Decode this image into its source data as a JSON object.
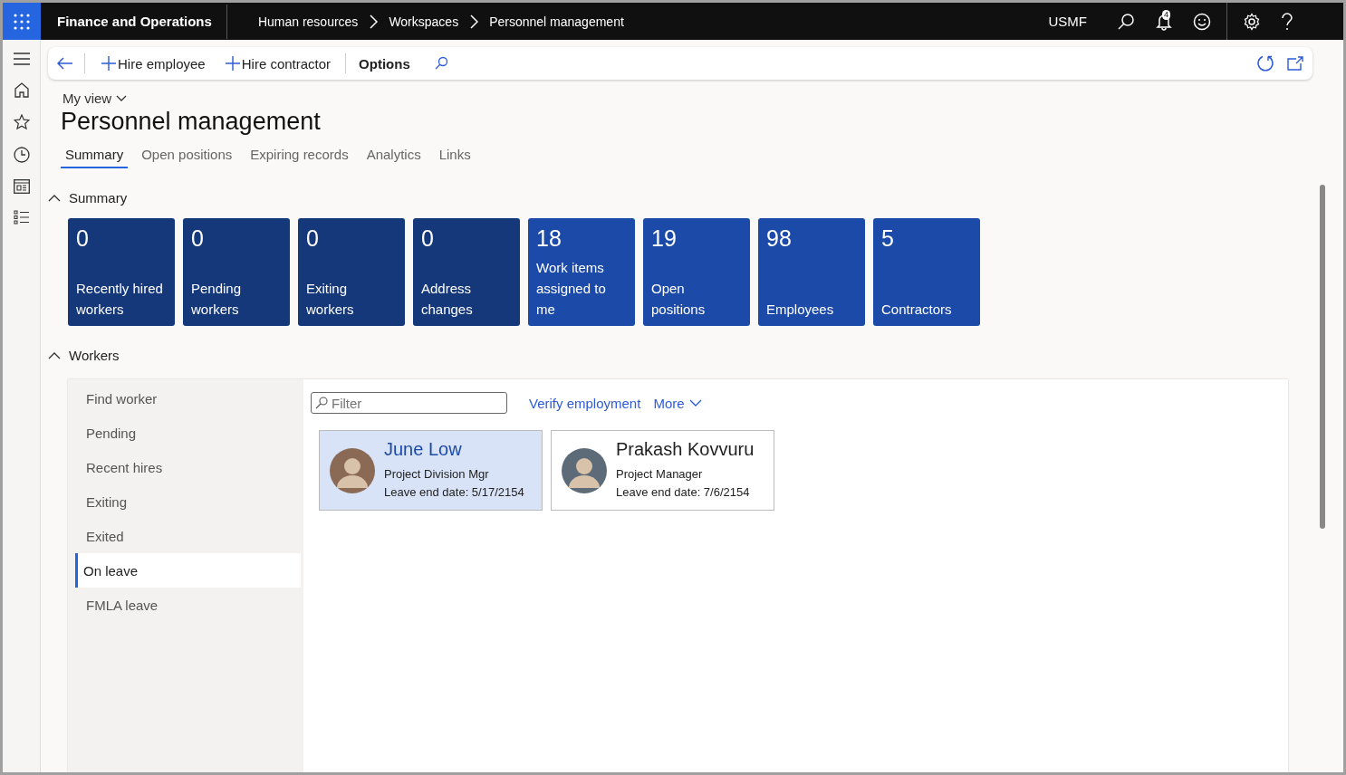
{
  "app": {
    "name": "Finance and Operations"
  },
  "breadcrumb": [
    "Human resources",
    "Workspaces",
    "Personnel management"
  ],
  "company": "USMF",
  "notifications": {
    "count": "4"
  },
  "action_pane": {
    "buttons": [
      {
        "label": "Hire employee",
        "kind": "add"
      },
      {
        "label": "Hire contractor",
        "kind": "add"
      },
      {
        "label": "Options",
        "kind": "plain"
      }
    ]
  },
  "view": {
    "label": "My view"
  },
  "page_title": "Personnel management",
  "tabs": [
    {
      "label": "Summary",
      "selected": true
    },
    {
      "label": "Open positions",
      "selected": false
    },
    {
      "label": "Expiring records",
      "selected": false
    },
    {
      "label": "Analytics",
      "selected": false
    },
    {
      "label": "Links",
      "selected": false
    }
  ],
  "summary": {
    "title": "Summary",
    "expanded": true,
    "tiles": [
      {
        "count": "0",
        "label": "Recently hired workers",
        "color": "#14387a"
      },
      {
        "count": "0",
        "label": "Pending workers",
        "color": "#14387a"
      },
      {
        "count": "0",
        "label": "Exiting workers",
        "color": "#14387a"
      },
      {
        "count": "0",
        "label": "Address changes",
        "color": "#14387a"
      },
      {
        "count": "18",
        "label": "Work items assigned to me",
        "color": "#1c4aa8"
      },
      {
        "count": "19",
        "label": "Open positions",
        "color": "#1c4aa8"
      },
      {
        "count": "98",
        "label": "Employees",
        "color": "#1c4aa8"
      },
      {
        "count": "5",
        "label": "Contractors",
        "color": "#1c4aa8"
      }
    ]
  },
  "workers": {
    "title": "Workers",
    "expanded": true,
    "filters": [
      {
        "label": "Find worker",
        "selected": false
      },
      {
        "label": "Pending",
        "selected": false
      },
      {
        "label": "Recent hires",
        "selected": false
      },
      {
        "label": "Exiting",
        "selected": false
      },
      {
        "label": "Exited",
        "selected": false
      },
      {
        "label": "On leave",
        "selected": true
      },
      {
        "label": "FMLA leave",
        "selected": false
      }
    ],
    "filter_field": {
      "placeholder": "Filter"
    },
    "actions": [
      "Verify employment",
      "More"
    ],
    "cards": [
      {
        "name": "June Low",
        "title": "Project Division Mgr",
        "detail": "Leave end date: 5/17/2154",
        "selected": true
      },
      {
        "name": "Prakash Kovvuru",
        "title": "Project Manager",
        "detail": "Leave end date: 7/6/2154",
        "selected": false
      }
    ]
  }
}
